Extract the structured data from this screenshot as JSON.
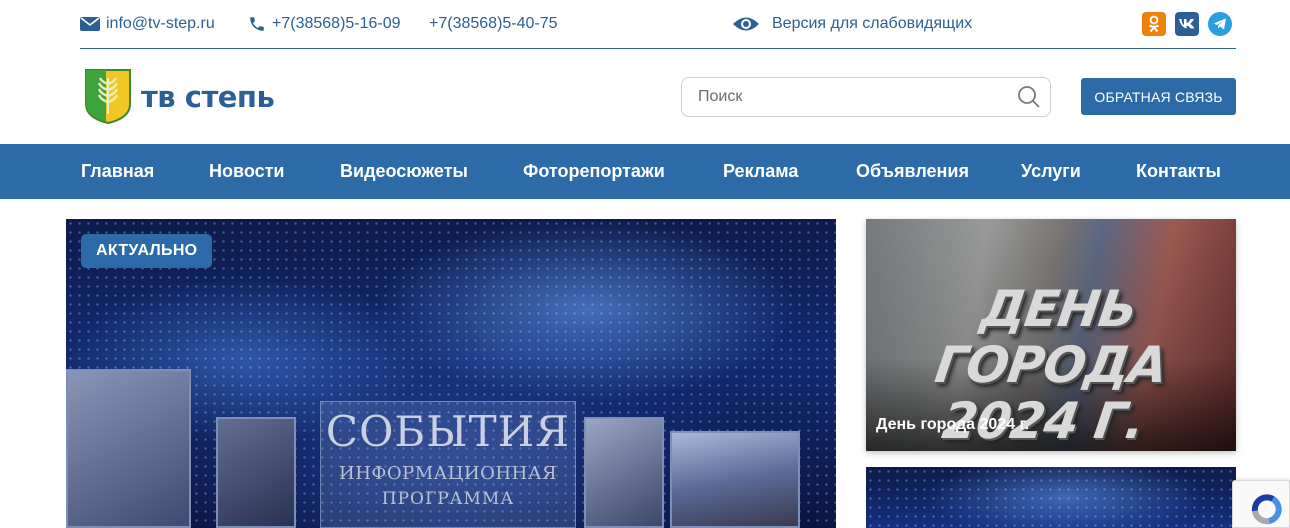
{
  "topbar": {
    "email": "info@tv-step.ru",
    "phone1": "+7(38568)5-16-09",
    "phone2": "+7(38568)5-40-75",
    "accessibility": "Версия для слабовидящих",
    "socials": [
      "odnoklassniki-icon",
      "vk-icon",
      "telegram-icon"
    ]
  },
  "header": {
    "brand": "тв степь",
    "search_placeholder": "Поиск",
    "feedback_label": "ОБРАТНАЯ СВЯЗЬ"
  },
  "nav": {
    "items": [
      "Главная",
      "Новости",
      "Видеосюжеты",
      "Фоторепортажи",
      "Реклама",
      "Объявления",
      "Услуги",
      "Контакты"
    ]
  },
  "banner": {
    "badge": "АКТУАЛЬНО",
    "title": "СОБЫТИЯ",
    "subtitle1": "ИНФОРМАЦИОННАЯ",
    "subtitle2": "ПРОГРАММА"
  },
  "side": {
    "card1_art_line1": "ДЕНЬ ГОРОДА",
    "card1_art_line2": "2024 Г.",
    "card1_caption": "День города 2024 г."
  },
  "colors": {
    "brand_blue": "#2c6ba8",
    "text_blue": "#2c5f95",
    "ok_orange": "#ee8208",
    "telegram": "#2a9ee0"
  }
}
